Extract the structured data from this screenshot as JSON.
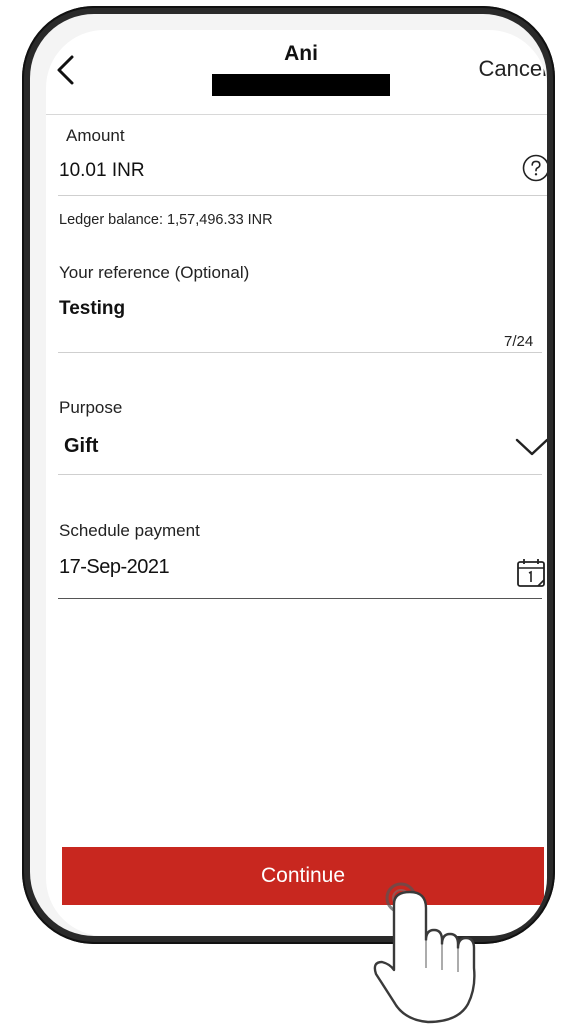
{
  "header": {
    "title": "Ani",
    "cancel_label": "Cancel"
  },
  "amount": {
    "label": "Amount",
    "value": "10.01 INR",
    "ledger_balance": "Ledger balance: 1,57,496.33 INR"
  },
  "reference": {
    "label": "Your reference (Optional)",
    "value": "Testing",
    "counter": "7/24"
  },
  "purpose": {
    "label": "Purpose",
    "value": "Gift"
  },
  "schedule": {
    "label": "Schedule payment",
    "value": "17-Sep-2021"
  },
  "continue_label": "Continue",
  "icons": {
    "back": "chevron-left-icon",
    "help": "question-circle-icon",
    "dropdown": "chevron-down-icon",
    "calendar": "calendar-icon",
    "tap": "hand-pointer-icon"
  },
  "colors": {
    "primary": "#c8271f",
    "divider": "#cfcfcf"
  }
}
